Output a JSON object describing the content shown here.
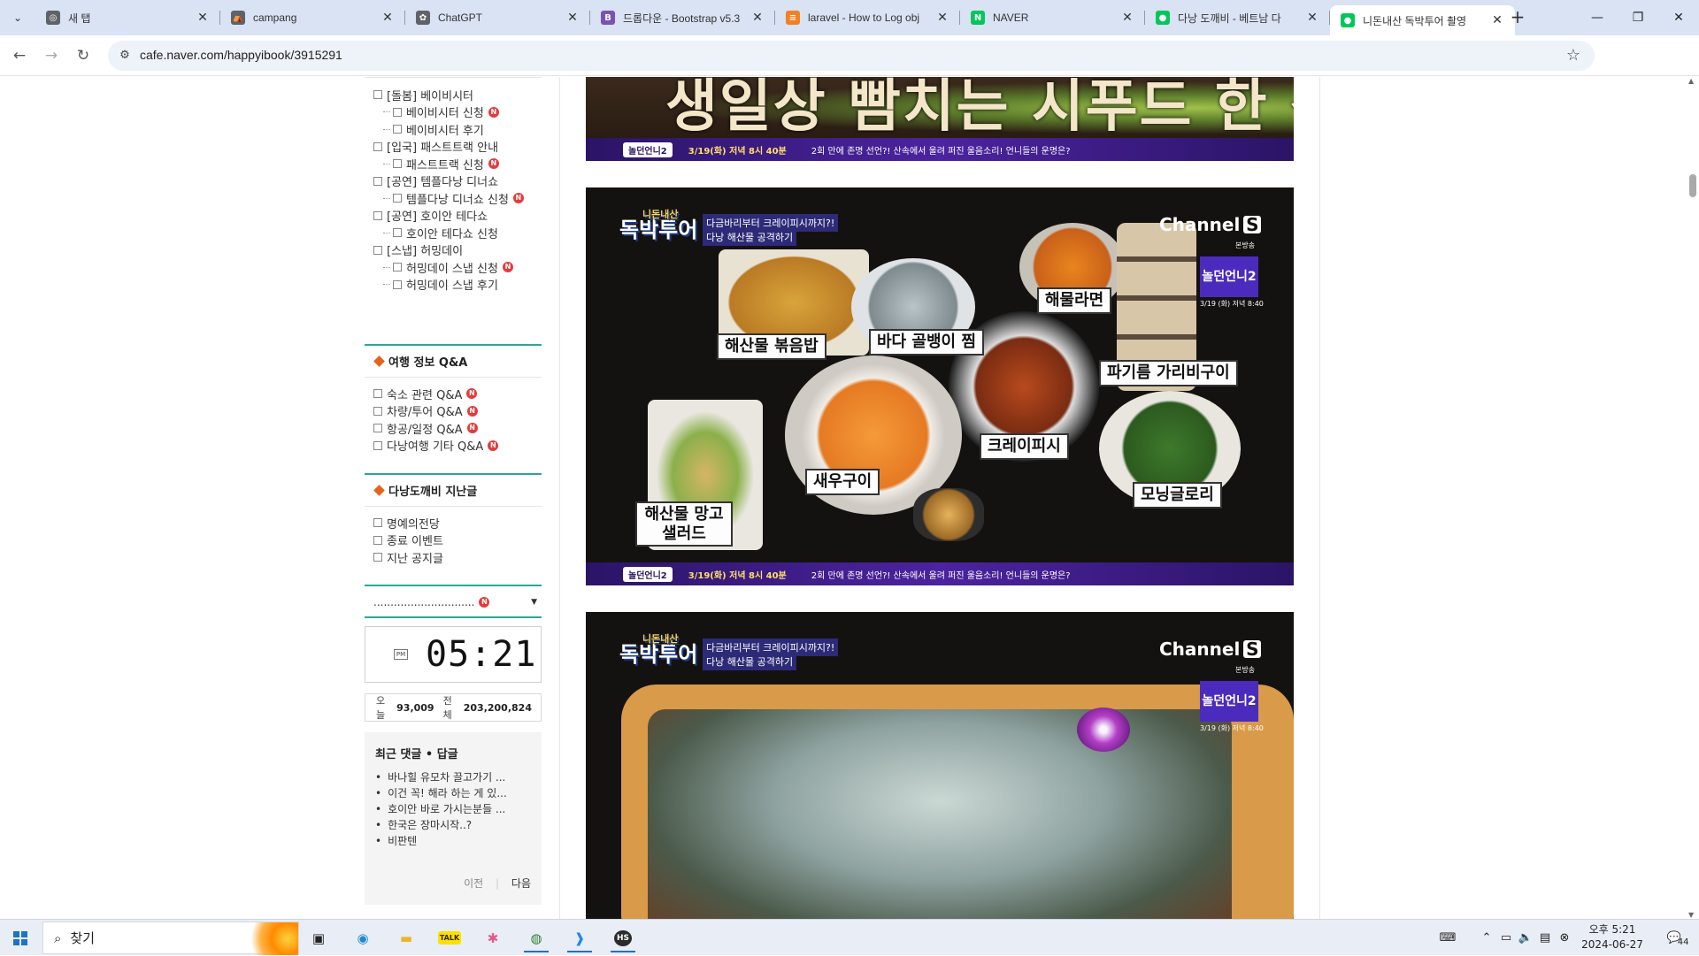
{
  "browser": {
    "tabs": [
      {
        "title": "새 탭",
        "fav_color": "#5f6368",
        "fav_glyph": "◎"
      },
      {
        "title": "campang",
        "fav_color": "#5f6368",
        "fav_glyph": "⛺"
      },
      {
        "title": "ChatGPT",
        "fav_color": "#5f6368",
        "fav_glyph": "✿"
      },
      {
        "title": "드롭다운 - Bootstrap v5.3",
        "fav_color": "#7952b3",
        "fav_glyph": "B"
      },
      {
        "title": "laravel - How to Log obj",
        "fav_color": "#f48024",
        "fav_glyph": "≡"
      },
      {
        "title": "NAVER",
        "fav_color": "#03c75a",
        "fav_glyph": "N"
      },
      {
        "title": "다낭 도깨비 - 베트남 다",
        "fav_color": "#03c75a",
        "fav_glyph": "●"
      },
      {
        "title": "니돈내산 독박투어 촬영",
        "fav_color": "#03c75a",
        "fav_glyph": "●"
      }
    ],
    "url": "cafe.naver.com/happyibook/3915291",
    "colors": {
      "tabstrip": "#d9e3f4",
      "accent": "#2fa59b",
      "badge": "#e53b3b"
    }
  },
  "sidebar": {
    "menu1": [
      {
        "label": "[돌봄] 베이비시터",
        "sub": false,
        "new": false
      },
      {
        "label": "베이비시터 신청",
        "sub": true,
        "new": true
      },
      {
        "label": "베이비시터 후기",
        "sub": true,
        "new": false
      },
      {
        "label": "[입국] 패스트트랙 안내",
        "sub": false,
        "new": false
      },
      {
        "label": "패스트트랙 신청",
        "sub": true,
        "new": true
      },
      {
        "label": "[공연] 템플다낭 디너쇼",
        "sub": false,
        "new": false
      },
      {
        "label": "템플다낭 디너쇼 신청",
        "sub": true,
        "new": true
      },
      {
        "label": "[공연] 호이안 테다쇼",
        "sub": false,
        "new": false
      },
      {
        "label": "호이안 테다쇼 신청",
        "sub": true,
        "new": false
      },
      {
        "label": "[스냅] 허밍데이",
        "sub": false,
        "new": false
      },
      {
        "label": "허밍데이 스냅 신청",
        "sub": true,
        "new": true
      },
      {
        "label": "허밍데이 스냅 후기",
        "sub": true,
        "new": false
      }
    ],
    "section_qa": "여행 정보 Q&A",
    "menu2": [
      {
        "label": "숙소 관련 Q&A",
        "new": true
      },
      {
        "label": "차량/투어 Q&A",
        "new": true
      },
      {
        "label": "항공/일정 Q&A",
        "new": true
      },
      {
        "label": "다낭여행 기타 Q&A",
        "new": true
      }
    ],
    "section_past": "다낭도깨비 지난글",
    "menu3": [
      {
        "label": "명예의전당"
      },
      {
        "label": "종료 이벤트"
      },
      {
        "label": "지난 공지글"
      }
    ],
    "dropdown_label": "..............................",
    "clock": {
      "ampm": "PM",
      "time": "05:21"
    },
    "visits": {
      "today_label": "오늘",
      "today": "93,009",
      "total_label": "전체",
      "total": "203,200,824"
    },
    "recent": {
      "title": "최근 댓글 • 답글",
      "items": [
        "바나힐 유모차 끌고가기 ...",
        "이건 꼭! 해라 하는 게 있...",
        "호이안 바로 가시는분들 ...",
        "한국은 장마시작..?",
        "비판텐"
      ],
      "prev": "이전",
      "next": "다음"
    }
  },
  "content": {
    "image1": {
      "title": "생일상 빰치는 시푸드 한 상"
    },
    "banner": {
      "tag": "놀던언니2",
      "date": "3/19(화) 저녁 8시 40분",
      "text": "2회 만에 존명 선언?! 산속에서 울려 퍼진 울음소리! 언니들의 운명은?"
    },
    "image2": {
      "show_small": "니돈내산",
      "show": "독박투어",
      "episode1": "다금바리부터 크레이피시까지?!",
      "episode2": "다낭 해산물 공격하기",
      "channel": "Channel",
      "channel_s": "S",
      "channel_sub": "본방송",
      "show_badge": "놀던언니2",
      "show_date": "3/19 (화) 저녁 8:40",
      "labels": [
        "해산물 볶음밥",
        "바다 골뱅이 찜",
        "해물라면",
        "파기름 가리비구이",
        "크레이피시",
        "새우구이",
        "해산물 망고 샐러드",
        "모닝글로리"
      ]
    }
  },
  "taskbar": {
    "search": "찾기",
    "clock_time": "오후 5:21",
    "clock_date": "2024-06-27",
    "notification_count": "44"
  }
}
